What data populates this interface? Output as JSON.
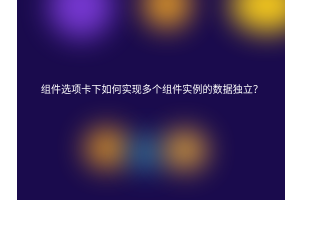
{
  "article": {
    "title": "   组件选项卡下如何实现多个组件实例的数据独立？"
  },
  "colors": {
    "background": "#1a0b4d",
    "text": "#ffffff",
    "glow_purple": "#7b3ad8",
    "glow_orange": "#f5a623",
    "glow_yellow": "#ffd21a",
    "glow_blue": "#2aa8d8"
  }
}
